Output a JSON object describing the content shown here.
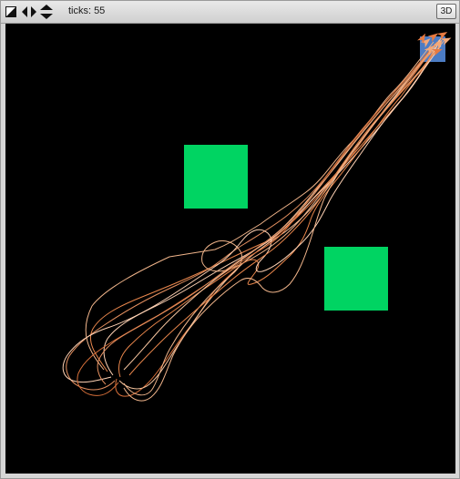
{
  "toolbar": {
    "icons": [
      "edit-shape-icon",
      "horizontal-arrows-icon",
      "vertical-arrows-icon"
    ],
    "ticks_label": "ticks:",
    "ticks_value": "55",
    "view_3d_label": "3D"
  },
  "world": {
    "background": "#000000",
    "obstacle_color": "#00d462",
    "goal_color": "#4c7cc4",
    "trail_colors": [
      "#f0b48a",
      "#e8864c",
      "#ffd2b4",
      "#d8703a",
      "#f6c49e",
      "#e59060"
    ]
  }
}
